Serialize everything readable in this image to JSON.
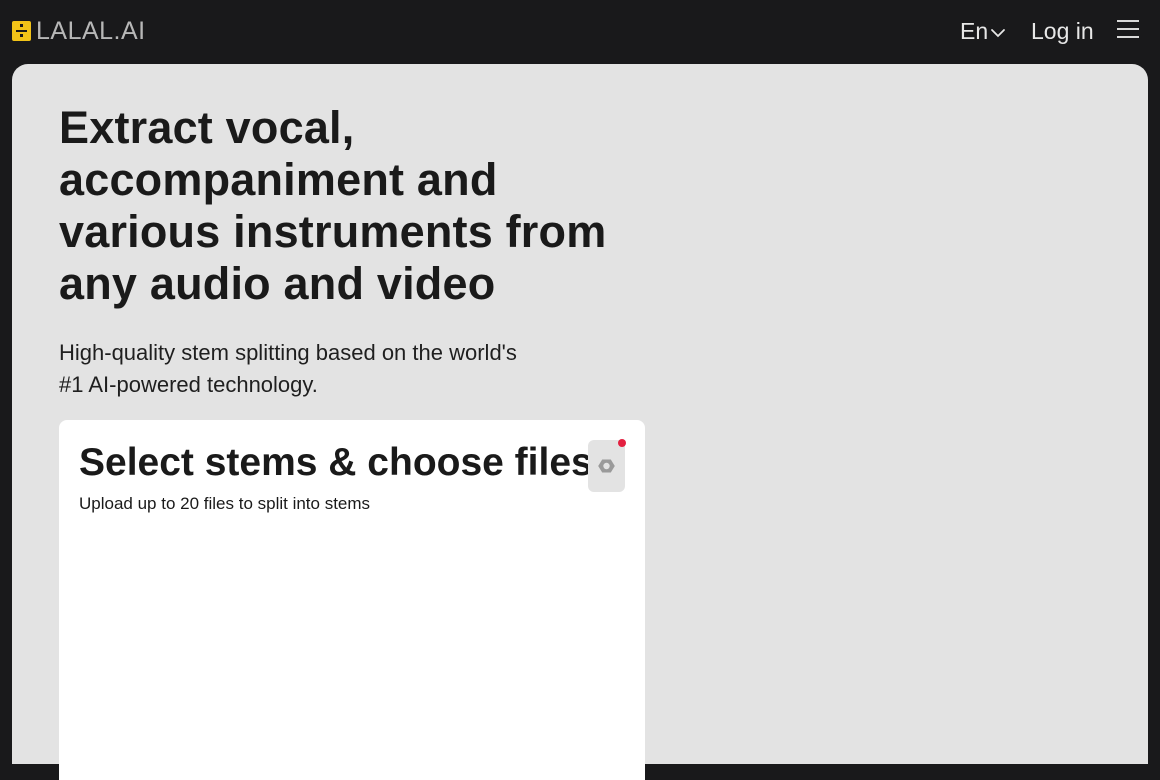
{
  "header": {
    "logo_text": "LALAL.AI",
    "language": "En",
    "login_label": "Log in",
    "icons": {
      "logo": "lalal-logo-icon",
      "chevron": "chevron-down-icon",
      "menu": "hamburger-menu-icon"
    }
  },
  "hero": {
    "headline": "Extract vocal, accompaniment and various instruments from any audio and video",
    "subtitle": "High-quality stem splitting based on the world's #1 AI-powered technology."
  },
  "upload_card": {
    "title": "Select stems & choose files",
    "subtitle": "Upload up to 20 files to split into stems",
    "settings_icon": "settings-icon",
    "notification_color": "#e32040"
  },
  "colors": {
    "topbar_bg": "#19191b",
    "page_bg": "#e3e3e3",
    "brand_yellow": "#f2c318",
    "card_bg": "#ffffff"
  }
}
